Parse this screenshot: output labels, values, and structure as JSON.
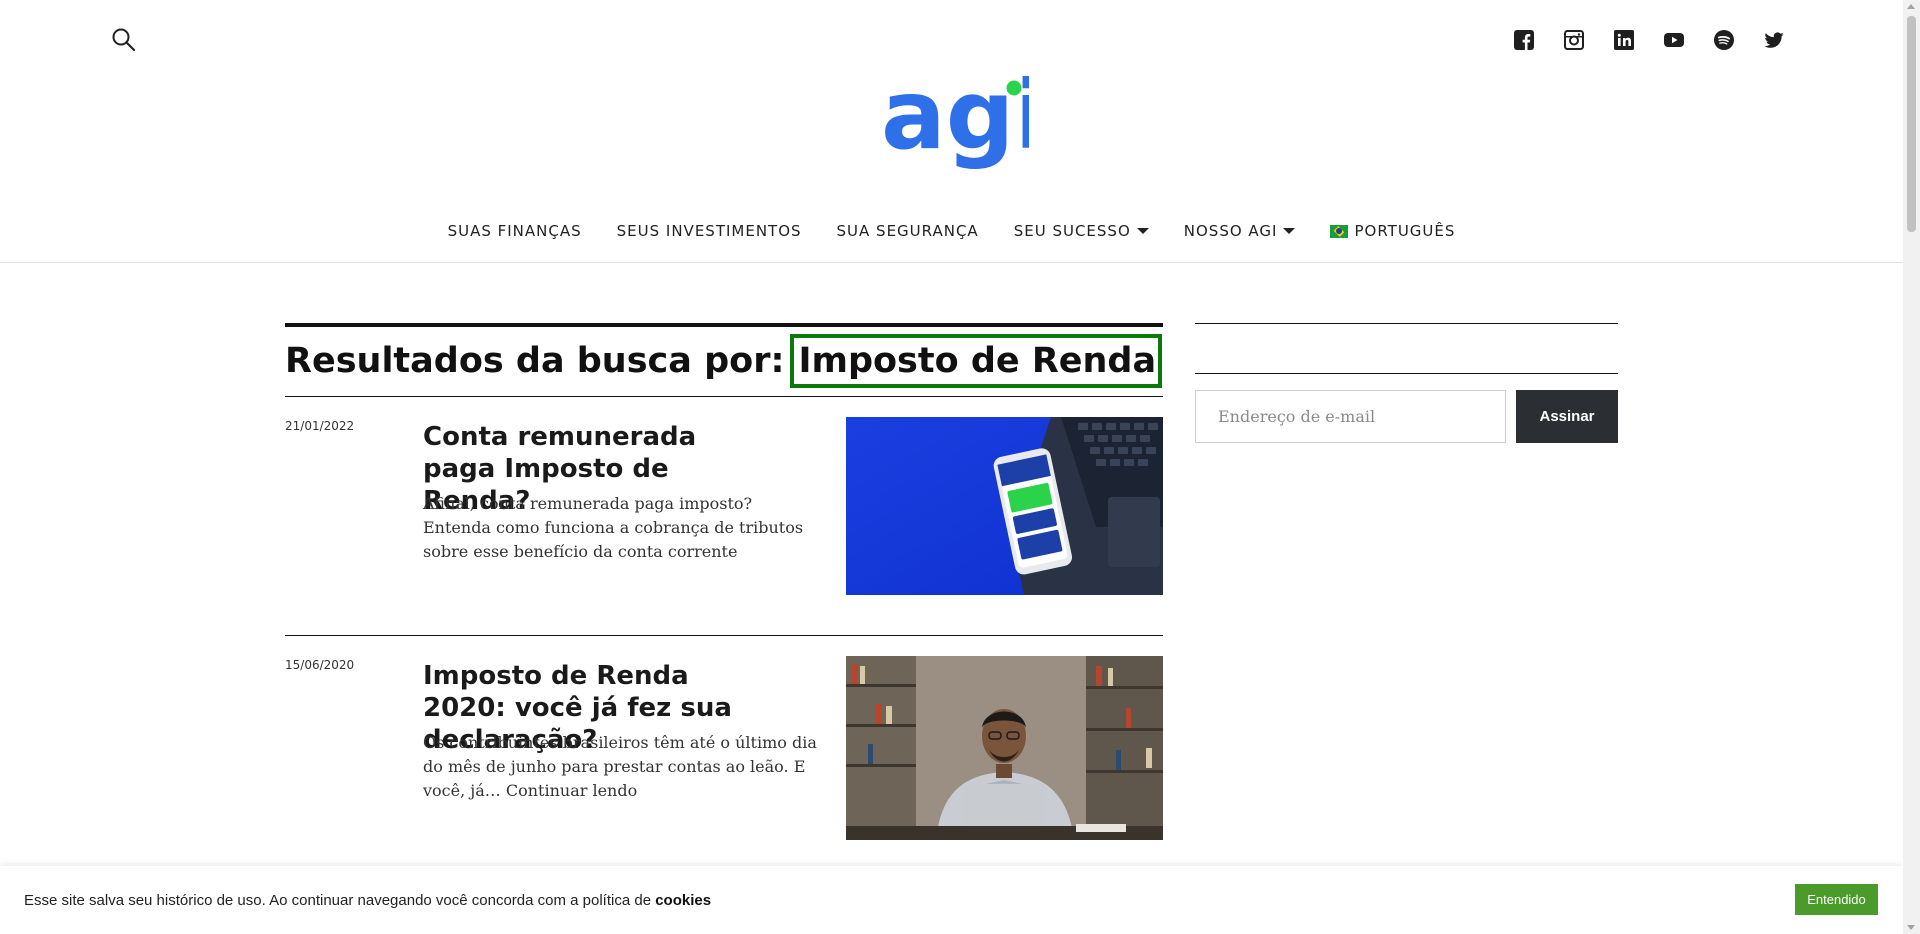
{
  "header": {
    "search_icon": "search-icon",
    "socials": [
      "facebook-icon",
      "instagram-icon",
      "linkedin-icon",
      "youtube-icon",
      "spotify-icon",
      "twitter-icon"
    ],
    "logo_text": "agi",
    "brand_colors": {
      "blue": "#2f6fe8",
      "green": "#2bd34a"
    }
  },
  "nav": {
    "items": [
      {
        "label": "SUAS FINANÇAS"
      },
      {
        "label": "SEUS INVESTIMENTOS"
      },
      {
        "label": "SUA SEGURANÇA"
      },
      {
        "label": "SEU SUCESSO"
      },
      {
        "label": "NOSSO AGI"
      },
      {
        "label": "PORTUGUÊS"
      }
    ]
  },
  "search": {
    "prefix": "Resultados da busca por:",
    "term": "Imposto de Renda"
  },
  "posts": [
    {
      "date": "21/01/2022",
      "title": "Conta remunerada paga Imposto de Renda?",
      "excerpt": "Afinal, conta remunerada paga imposto? Entenda como funciona a cobrança de tributos sobre esse benefício da conta corrente"
    },
    {
      "date": "15/06/2020",
      "title": "Imposto de Renda 2020: você já fez sua declaração?",
      "excerpt": "Os contribuintes brasileiros têm até o último dia do mês de junho para prestar contas ao leão. E você, já… Continuar lendo"
    }
  ],
  "sidebar": {
    "email_placeholder": "Endereço de e-mail",
    "subscribe_label": "Assinar"
  },
  "cookie_bar": {
    "text": "Esse site salva seu histórico de uso. Ao continuar navegando você concorda com a política de",
    "link": "cookies",
    "button": "Entendido"
  }
}
